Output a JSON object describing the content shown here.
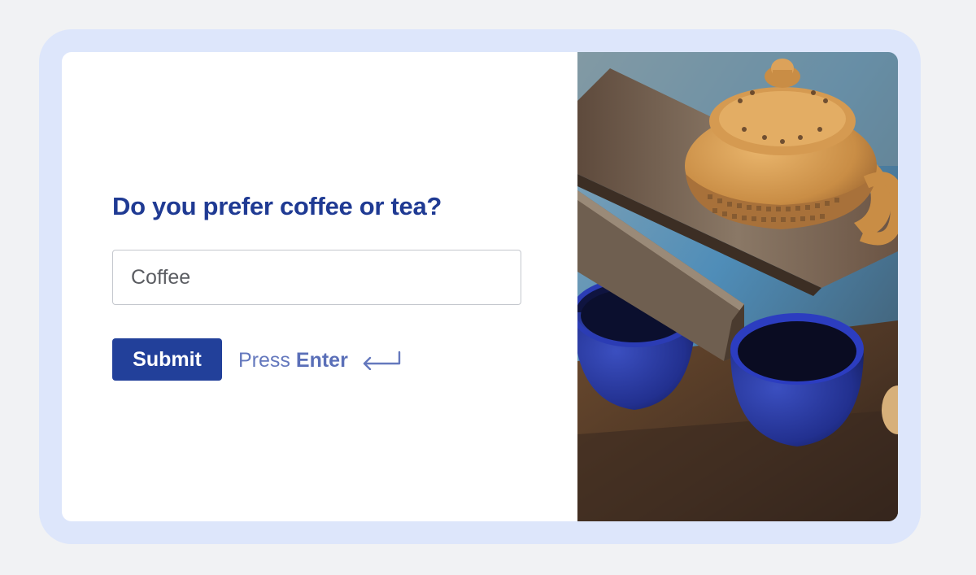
{
  "question": {
    "text": "Do you prefer coffee or tea?"
  },
  "answer_input": {
    "value": "Coffee",
    "placeholder": ""
  },
  "actions": {
    "submit_label": "Submit",
    "hint_prefix": "Press",
    "hint_key": "Enter",
    "hint_icon": "enter-arrow-icon"
  },
  "photo": {
    "subject": "teapot-and-cups-photo"
  },
  "colors": {
    "accent": "#22409a",
    "heading": "#1f3a93",
    "frame": "#dde6fb",
    "page_background": "#f1f2f4"
  }
}
